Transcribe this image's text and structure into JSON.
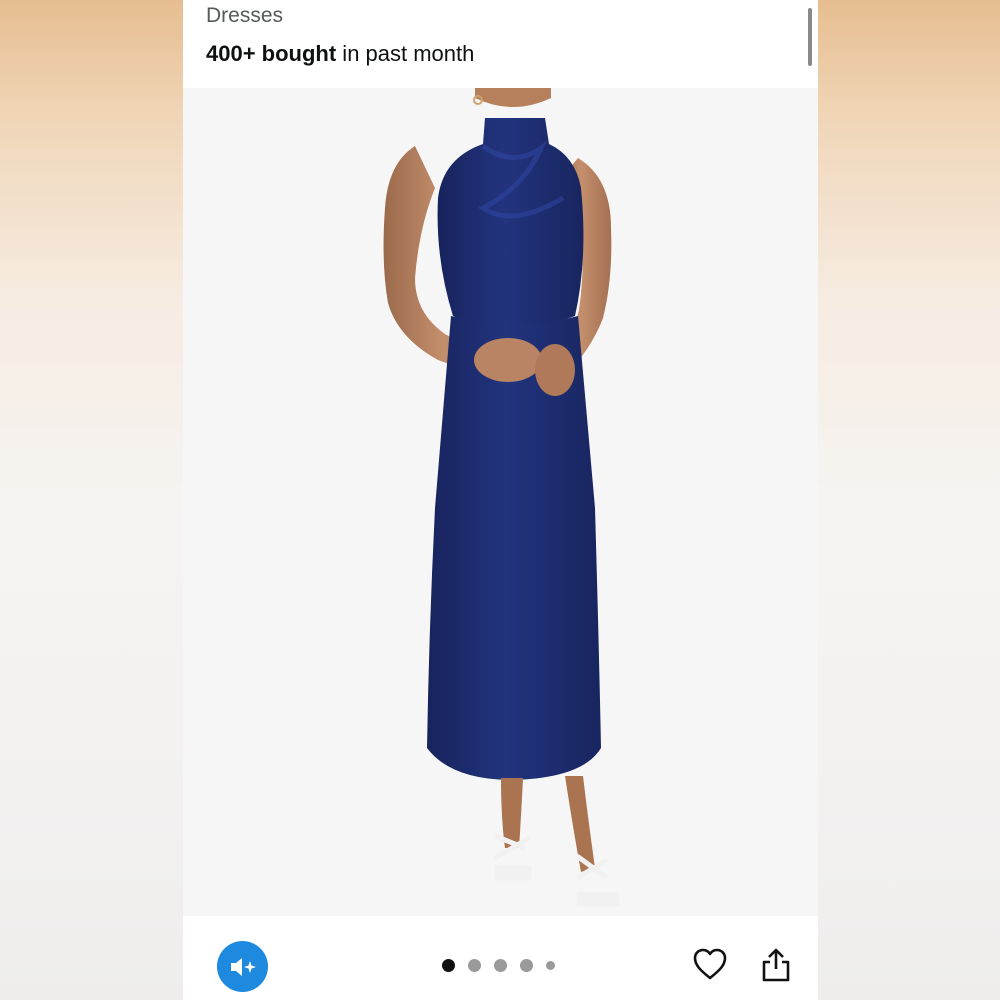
{
  "header": {
    "category": "Dresses",
    "bought_bold": "400+ bought",
    "bought_rest": " in past month"
  },
  "product_image": {
    "description": "model in navy blue satin mock-neck sleeveless midi dress with white strappy sandals",
    "dress_color": "#1b2a6b",
    "background_color": "#f7f6f6"
  },
  "gallery": {
    "dots": [
      {
        "state": "active"
      },
      {
        "state": "inactive"
      },
      {
        "state": "inactive"
      },
      {
        "state": "inactive"
      },
      {
        "state": "inactive-small"
      }
    ]
  },
  "actions": {
    "mute_icon": "speaker-mute-sparkle-icon",
    "favorite_icon": "heart-icon",
    "share_icon": "share-icon",
    "accent_color": "#1d8ae0"
  }
}
